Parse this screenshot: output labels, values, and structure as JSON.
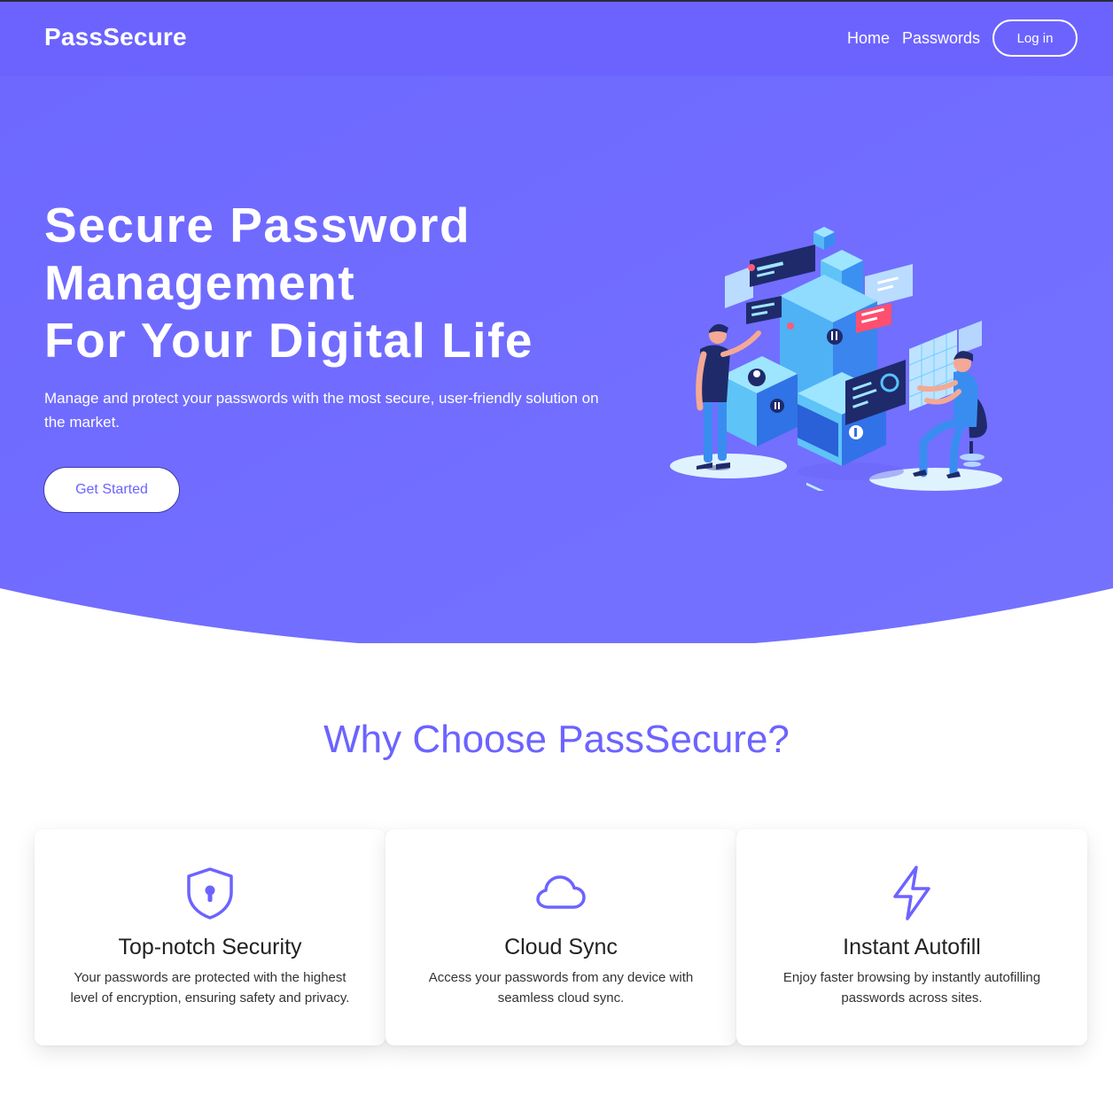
{
  "colors": {
    "brand": "#6c63ff",
    "hero_bg": "#716cff",
    "text_dark": "#222222",
    "white": "#ffffff"
  },
  "navbar": {
    "brand": "PassSecure",
    "links": [
      "Home",
      "Passwords"
    ],
    "login_label": "Log in"
  },
  "hero": {
    "title_lines": [
      "Secure Password",
      "Management",
      "For Your Digital Life"
    ],
    "subtitle": "Manage and protect your passwords with the most secure, user-friendly solution on the market.",
    "cta_label": "Get Started",
    "illustration": "isometric-data-security-illustration"
  },
  "features": {
    "title": "Why Choose PassSecure?",
    "cards": [
      {
        "icon": "shield-lock-icon",
        "title": "Top-notch Security",
        "text": "Your passwords are protected with the highest level of encryption, ensuring safety and privacy."
      },
      {
        "icon": "cloud-icon",
        "title": "Cloud Sync",
        "text": "Access your passwords from any device with seamless cloud sync."
      },
      {
        "icon": "lightning-bolt-icon",
        "title": "Instant Autofill",
        "text": "Enjoy faster browsing by instantly autofilling passwords across sites."
      }
    ]
  }
}
